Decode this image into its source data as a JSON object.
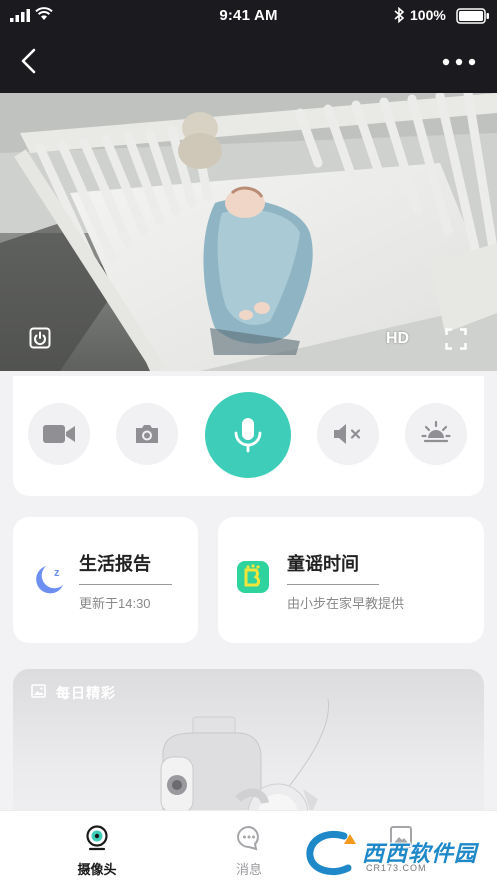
{
  "status_bar": {
    "time": "9:41 AM",
    "battery": "100%"
  },
  "nav": {
    "back_icon": "chevron-left-icon",
    "more_icon": "more-horizontal-icon"
  },
  "video": {
    "hd_label": "HD"
  },
  "controls": {
    "items": [
      "video-record-icon",
      "camera-snapshot-icon",
      "microphone-icon",
      "speaker-mute-icon",
      "brightness-icon"
    ],
    "accent_color": "#3ecdb9"
  },
  "cards": {
    "life_report": {
      "title": "生活报告",
      "subtitle": "更新于14:30"
    },
    "nursery_rhymes": {
      "title": "童谣时间",
      "subtitle": "由小步在家早教提供"
    }
  },
  "daily": {
    "title": "每日精彩"
  },
  "tabbar": {
    "tabs": [
      {
        "label": "摄像头",
        "active": true
      },
      {
        "label": "消息",
        "active": false
      },
      {
        "label": "",
        "active": false
      }
    ]
  },
  "watermark": {
    "brand": "西西软件园",
    "url": "CR173.COM"
  }
}
